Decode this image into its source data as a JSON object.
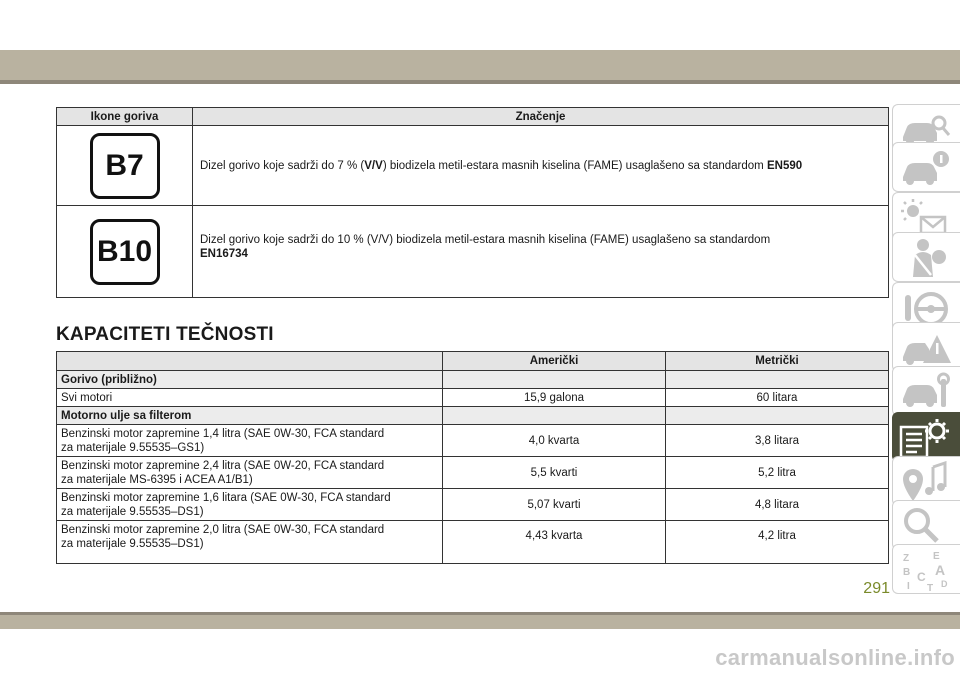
{
  "fuel_table": {
    "headers": [
      "Ikone goriva",
      "Značenje"
    ],
    "rows": [
      {
        "badge": "B7",
        "text_before": "Dizel gorivo koje sadrži do 7 % (",
        "text_bold": "V/V",
        "text_after": ") biodizela metil-estara masnih kiselina (FAME) usaglašeno sa standardom ",
        "standard": "EN590"
      },
      {
        "badge": "B10",
        "text": "Dizel gorivo koje sadrži do 10 % (V/V) biodizela metil-estara masnih kiselina (FAME) usaglašeno sa standardom",
        "standard": "EN16734"
      }
    ]
  },
  "section_title": "KAPACITETI TEČNOSTI",
  "capacities": {
    "headers": [
      "",
      "Američki",
      "Metrički"
    ],
    "group1": "Gorivo (približno)",
    "row_fuel": {
      "label": "Svi motori",
      "us": "15,9 galona",
      "metric": "60 litara"
    },
    "group2": "Motorno ulje sa filterom",
    "oil_rows": [
      {
        "line1": "Benzinski motor zapremine 1,4 litra (SAE 0W-30, FCA standard",
        "line2": "za materijale 9.55535–GS1)",
        "us": "4,0 kvarta",
        "metric": "3,8 litara"
      },
      {
        "line1": "Benzinski motor zapremine 2,4 litra (SAE 0W-20, FCA standard",
        "line2": "za materijale MS-6395 i ACEA A1/B1)",
        "us": "5,5 kvarti",
        "metric": "5,2 litra"
      },
      {
        "line1": "Benzinski motor zapremine 1,6 litara (SAE 0W-30, FCA standard",
        "line2": "za materijale 9.55535–DS1)",
        "us": "5,07 kvarti",
        "metric": "4,8 litara"
      },
      {
        "line1": "Benzinski motor zapremine 2,0 litra (SAE 0W-30, FCA standard",
        "line2": "za materijale 9.55535–DS1)",
        "us": "4,43 kvarta",
        "metric": "4,2 litra"
      }
    ]
  },
  "sidebar": {
    "tabs": [
      {
        "icon": "car-search-icon"
      },
      {
        "icon": "car-info-icon"
      },
      {
        "icon": "warning-light-message-icon"
      },
      {
        "icon": "seatbelt-airbag-icon"
      },
      {
        "icon": "steering-wheel-icon"
      },
      {
        "icon": "car-warning-triangle-icon"
      },
      {
        "icon": "car-wrench-icon"
      },
      {
        "icon": "specifications-gear-icon"
      },
      {
        "icon": "multimedia-music-icon"
      },
      {
        "icon": "search-magnifier-icon"
      },
      {
        "icon": "alphabetical-index-icon"
      }
    ],
    "active_index": 7,
    "index_letters": [
      "Z",
      "E",
      "B",
      "A",
      "C",
      "D",
      "I",
      "T"
    ]
  },
  "page_number": "291",
  "watermark": "carmanualsonline.info",
  "colors": {
    "band": "#b9b2a0",
    "active_tab": "#4a4d3a",
    "page_number": "#7a8a2a"
  }
}
